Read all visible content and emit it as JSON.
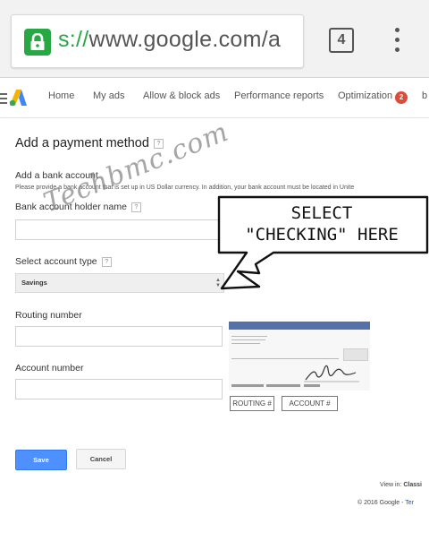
{
  "browser": {
    "url_scheme": "s://",
    "url_rest": "www.google.com/a",
    "tab_count": "4",
    "lock_color": "#27a844"
  },
  "nav": {
    "items": [
      "Home",
      "My ads",
      "Allow & block ads",
      "Performance reports",
      "Optimization",
      "b"
    ],
    "optimization_badge": "2"
  },
  "page": {
    "title": "Add a payment method",
    "help_mark": "?",
    "bank_section_title": "Add a bank account",
    "bank_section_note": "Please provide a bank account that is set up in US Dollar currency. In addition, your bank account must be located in Unite",
    "holder_name_label": "Bank account holder name",
    "account_type_label": "Select account type",
    "account_type_value": "Savings",
    "routing_label": "Routing number",
    "account_number_label": "Account number",
    "check_routing_label": "ROUTING #",
    "check_account_label": "ACCOUNT #",
    "save_label": "Save",
    "cancel_label": "Cancel"
  },
  "footer": {
    "view_in_prefix": "View in:",
    "view_in_link": "Classi",
    "copyright_prefix": "© 2016 Google -",
    "copyright_link": "Ter"
  },
  "annotation": {
    "watermark": "Techbmc.com",
    "callout_line1": "SELECT",
    "callout_line2": "\"CHECKING\" HERE"
  },
  "colors": {
    "save_button": "#4d90fe",
    "badge": "#dd4b39",
    "check_header": "#5572a8"
  }
}
